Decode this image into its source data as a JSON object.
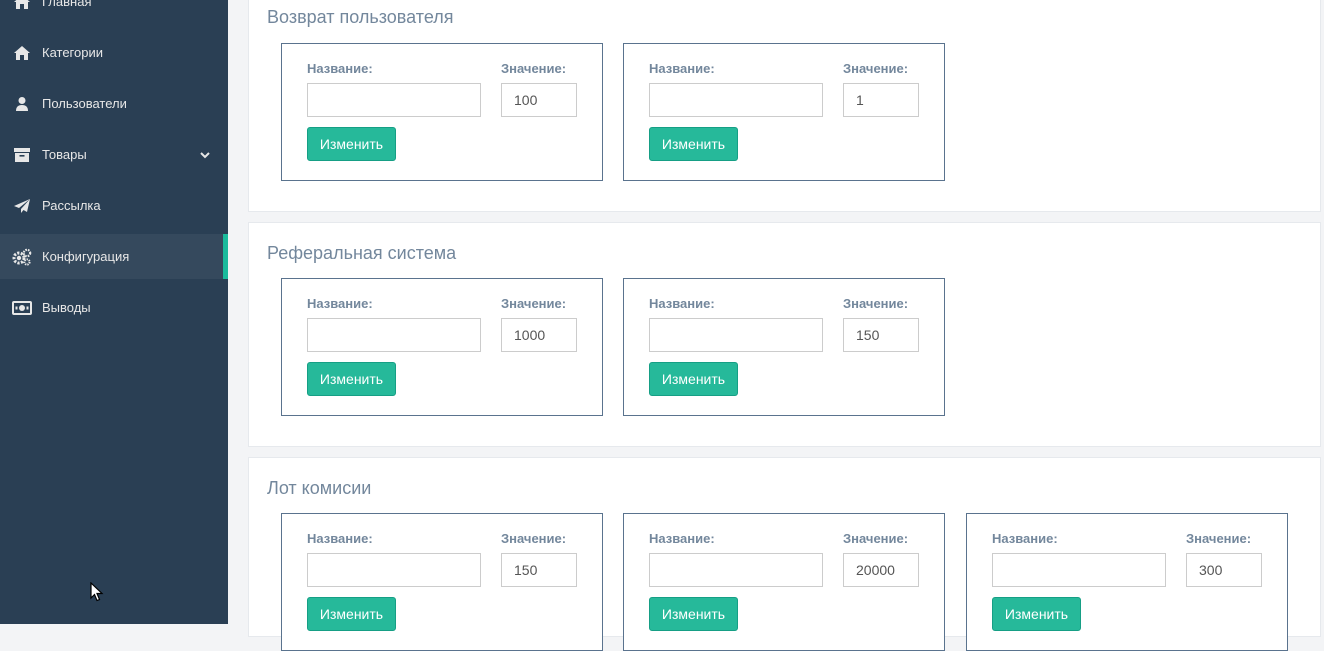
{
  "sidebar": {
    "items": [
      {
        "label": "Главная",
        "icon": "home-icon"
      },
      {
        "label": "Категории",
        "icon": "home-icon"
      },
      {
        "label": "Пользователи",
        "icon": "user-icon"
      },
      {
        "label": "Товары",
        "icon": "archive-icon"
      },
      {
        "label": "Рассылка",
        "icon": "paper-plane-icon"
      },
      {
        "label": "Конфигурация",
        "icon": "cogs-icon"
      },
      {
        "label": "Выводы",
        "icon": "money-icon"
      }
    ]
  },
  "labels": {
    "name": "Название:",
    "value": "Значение:",
    "button": "Изменить"
  },
  "sections": [
    {
      "title": "Возврат пользователя",
      "cards": [
        {
          "value": "100"
        },
        {
          "value": "1"
        }
      ]
    },
    {
      "title": "Реферальная система",
      "cards": [
        {
          "value": "1000"
        },
        {
          "value": "150"
        }
      ]
    },
    {
      "title": "Лот комисии",
      "cards": [
        {
          "value": "150"
        },
        {
          "value": "20000"
        },
        {
          "value": "300"
        }
      ]
    }
  ],
  "colors": {
    "sidebar_bg": "#2a3f54",
    "accent": "#1abb9c",
    "button": "#26b99a"
  }
}
